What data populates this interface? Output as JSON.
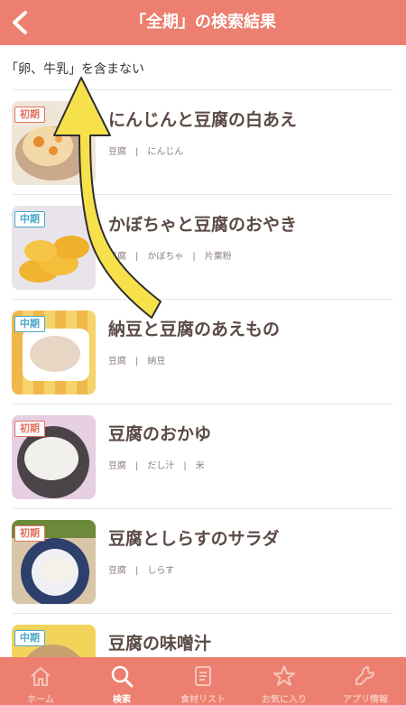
{
  "header": {
    "title": "「全期」の検索結果"
  },
  "filter": {
    "text": "「卵、牛乳」を含まない"
  },
  "recipes": [
    {
      "title": "にんじんと豆腐の白あえ",
      "stage": "初期",
      "stage_type": "early",
      "ingredients": [
        "豆腐",
        "にんじん"
      ]
    },
    {
      "title": "かぼちゃと豆腐のおやき",
      "stage": "中期",
      "stage_type": "mid",
      "ingredients": [
        "豆腐",
        "かぼちゃ",
        "片栗粉"
      ]
    },
    {
      "title": "納豆と豆腐のあえもの",
      "stage": "中期",
      "stage_type": "mid",
      "ingredients": [
        "豆腐",
        "納豆"
      ]
    },
    {
      "title": "豆腐のおかゆ",
      "stage": "初期",
      "stage_type": "early",
      "ingredients": [
        "豆腐",
        "だし汁",
        "米"
      ]
    },
    {
      "title": "豆腐としらすのサラダ",
      "stage": "初期",
      "stage_type": "early",
      "ingredients": [
        "豆腐",
        "しらす"
      ]
    },
    {
      "title": "豆腐の味噌汁",
      "stage": "中期",
      "stage_type": "mid",
      "ingredients": []
    }
  ],
  "tabs": [
    {
      "label": "ホーム",
      "icon": "home-icon"
    },
    {
      "label": "検索",
      "icon": "search-icon",
      "active": true
    },
    {
      "label": "食材リスト",
      "icon": "list-icon"
    },
    {
      "label": "お気に入り",
      "icon": "star-icon"
    },
    {
      "label": "アプリ情報",
      "icon": "wrench-icon"
    }
  ],
  "colors": {
    "header": "#ec7f6f",
    "title_text": "#5b4a45",
    "early_stage": "#e0725f",
    "mid_stage": "#4aa7c9",
    "annotation_arrow": "#f7e14b"
  }
}
